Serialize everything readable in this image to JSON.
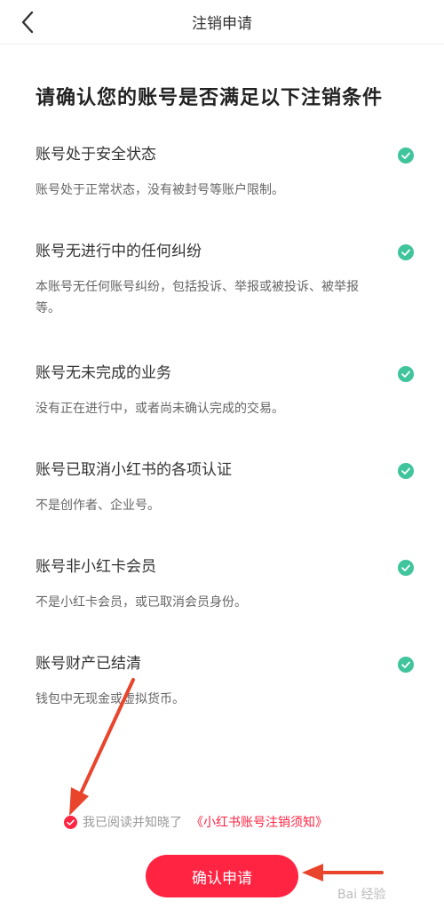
{
  "nav": {
    "title": "注销申请"
  },
  "heading": "请确认您的账号是否满足以下注销条件",
  "conditions": [
    {
      "title": "账号处于安全状态",
      "desc": "账号处于正常状态，没有被封号等账户限制。",
      "met": true
    },
    {
      "title": "账号无进行中的任何纠纷",
      "desc": "本账号无任何账号纠纷，包括投诉、举报或被投诉、被举报等。",
      "met": true
    },
    {
      "title": "账号无未完成的业务",
      "desc": "没有正在进行中，或者尚未确认完成的交易。",
      "met": true
    },
    {
      "title": "账号已取消小红书的各项认证",
      "desc": "不是创作者、企业号。",
      "met": true
    },
    {
      "title": "账号非小红卡会员",
      "desc": "不是小红卡会员，或已取消会员身份。",
      "met": true
    },
    {
      "title": "账号财产已结清",
      "desc": "钱包中无现金或虚拟货币。",
      "met": true
    }
  ],
  "agreement": {
    "text": "我已阅读并知晓了",
    "link": "《小红书账号注销须知》",
    "checked": true
  },
  "confirm_button": "确认申请",
  "watermark": "Bai 经验",
  "colors": {
    "accent": "#ff2442",
    "check": "#3fc49b",
    "annotation_arrow": "#e8452c"
  }
}
